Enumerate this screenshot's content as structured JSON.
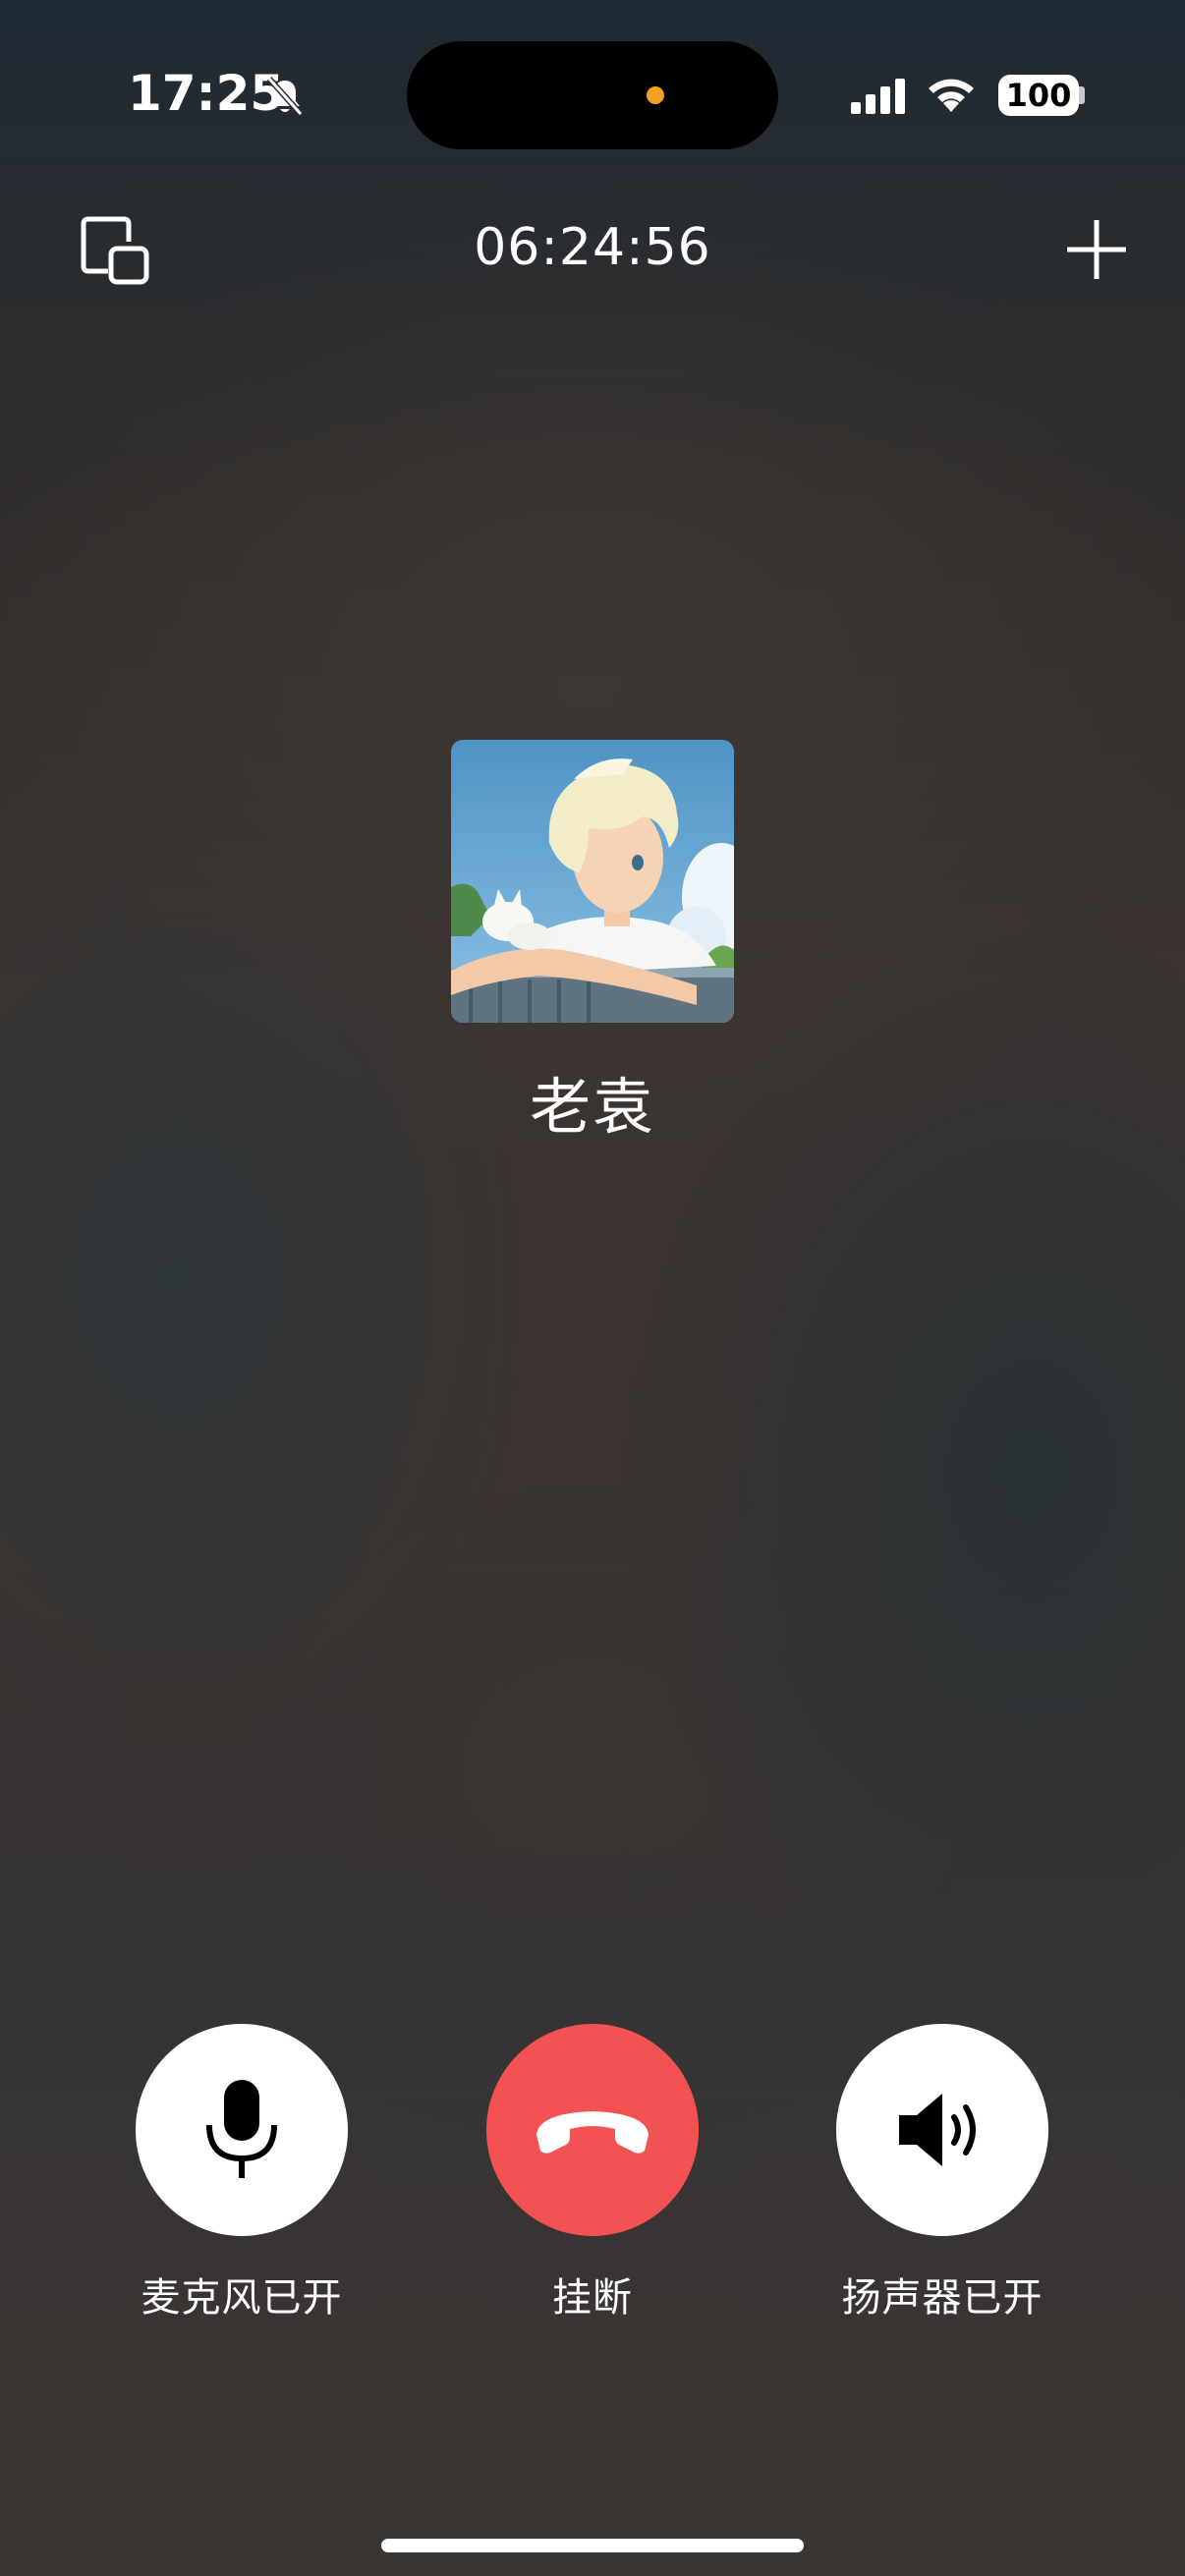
{
  "status_bar": {
    "time": "17:25",
    "silent_icon": "bell-slash-icon",
    "signal_icon": "cellular-signal-icon",
    "wifi_icon": "wifi-icon",
    "battery_level": "100",
    "island_indicator_color": "#f4a020"
  },
  "call": {
    "minimize_icon": "picture-in-picture-icon",
    "duration": "06:24:56",
    "add_icon": "plus-icon",
    "contact_name": "老袁",
    "avatar_image": "anime-boy-with-cat-avatar"
  },
  "controls": {
    "microphone": {
      "label": "麦克风已开",
      "icon": "microphone-icon"
    },
    "hangup": {
      "label": "挂断",
      "icon": "phone-hangup-icon",
      "color": "#f25252"
    },
    "speaker": {
      "label": "扬声器已开",
      "icon": "speaker-icon"
    }
  }
}
